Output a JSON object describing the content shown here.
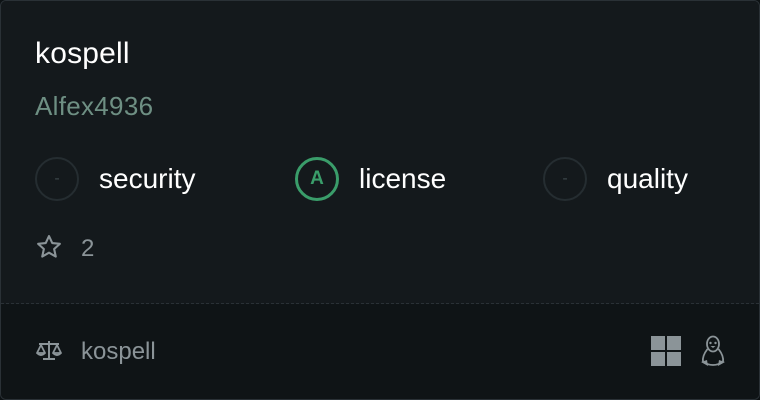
{
  "package": {
    "name": "kospell",
    "author": "Alfex4936"
  },
  "grades": [
    {
      "label": "security",
      "value": "-"
    },
    {
      "label": "license",
      "value": "A"
    },
    {
      "label": "quality",
      "value": "-"
    }
  ],
  "stars": {
    "icon": "star-icon",
    "count": "2"
  },
  "footer": {
    "license_icon": "scale-icon",
    "license_name": "kospell",
    "platforms": [
      "windows-icon",
      "linux-icon"
    ]
  },
  "colors": {
    "background": "#14191c",
    "accent_green": "#3a9d6a",
    "author_text": "#6e8f83",
    "muted_text": "#8b9498"
  }
}
